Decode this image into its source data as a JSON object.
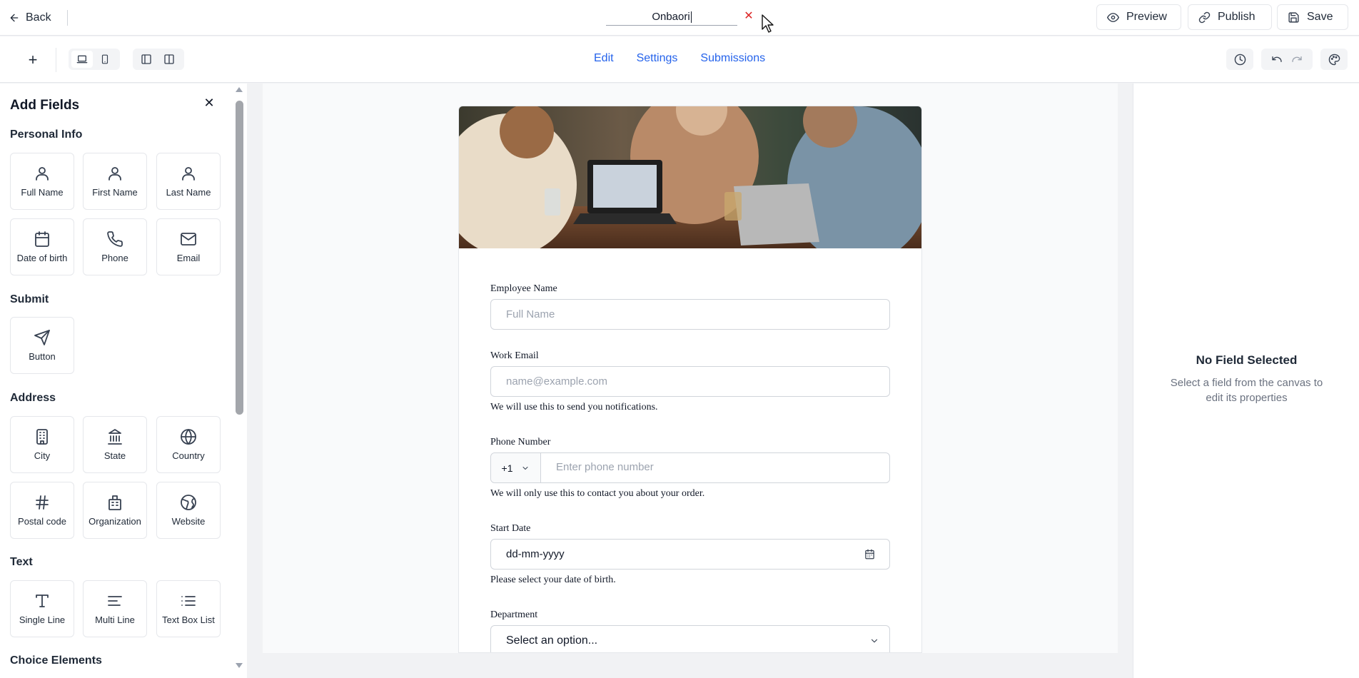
{
  "header": {
    "back_label": "Back",
    "form_title": "Onbaori",
    "preview_label": "Preview",
    "publish_label": "Publish",
    "save_label": "Save"
  },
  "toolbar": {
    "tabs": [
      {
        "label": "Edit"
      },
      {
        "label": "Settings"
      },
      {
        "label": "Submissions"
      }
    ],
    "add_symbol": "+"
  },
  "add_fields": {
    "title": "Add Fields",
    "sections": [
      {
        "title": "Personal Info",
        "items": [
          {
            "label": "Full Name",
            "icon": "user-icon"
          },
          {
            "label": "First Name",
            "icon": "user-icon"
          },
          {
            "label": "Last Name",
            "icon": "user-icon"
          },
          {
            "label": "Date of birth",
            "icon": "calendar-icon"
          },
          {
            "label": "Phone",
            "icon": "phone-icon"
          },
          {
            "label": "Email",
            "icon": "mail-icon"
          }
        ]
      },
      {
        "title": "Submit",
        "items": [
          {
            "label": "Button",
            "icon": "send-icon"
          }
        ]
      },
      {
        "title": "Address",
        "items": [
          {
            "label": "City",
            "icon": "building-icon"
          },
          {
            "label": "State",
            "icon": "landmark-icon"
          },
          {
            "label": "Country",
            "icon": "globe-icon"
          },
          {
            "label": "Postal code",
            "icon": "hash-icon"
          },
          {
            "label": "Organization",
            "icon": "office-icon"
          },
          {
            "label": "Website",
            "icon": "earth-icon"
          }
        ]
      },
      {
        "title": "Text",
        "items": [
          {
            "label": "Single Line",
            "icon": "type-icon"
          },
          {
            "label": "Multi Line",
            "icon": "align-left-icon"
          },
          {
            "label": "Text Box List",
            "icon": "list-icon"
          }
        ]
      },
      {
        "title": "Choice Elements",
        "items": []
      }
    ]
  },
  "form": {
    "fields": [
      {
        "label": "Employee Name",
        "placeholder": "Full Name"
      },
      {
        "label": "Work Email",
        "placeholder": "name@example.com",
        "help": "We will use this to send you notifications."
      },
      {
        "label": "Phone Number",
        "country_code": "+1",
        "placeholder": "Enter phone number",
        "help": "We will only use this to contact you about your order."
      },
      {
        "label": "Start Date",
        "value": "dd-mm-yyyy",
        "help": "Please select your date of birth."
      },
      {
        "label": "Department",
        "value": "Select an option..."
      }
    ]
  },
  "properties": {
    "title": "No Field Selected",
    "description": "Select a field from the canvas to edit its properties"
  },
  "colors": {
    "accent": "#2563eb",
    "close_red": "#dc2626"
  }
}
